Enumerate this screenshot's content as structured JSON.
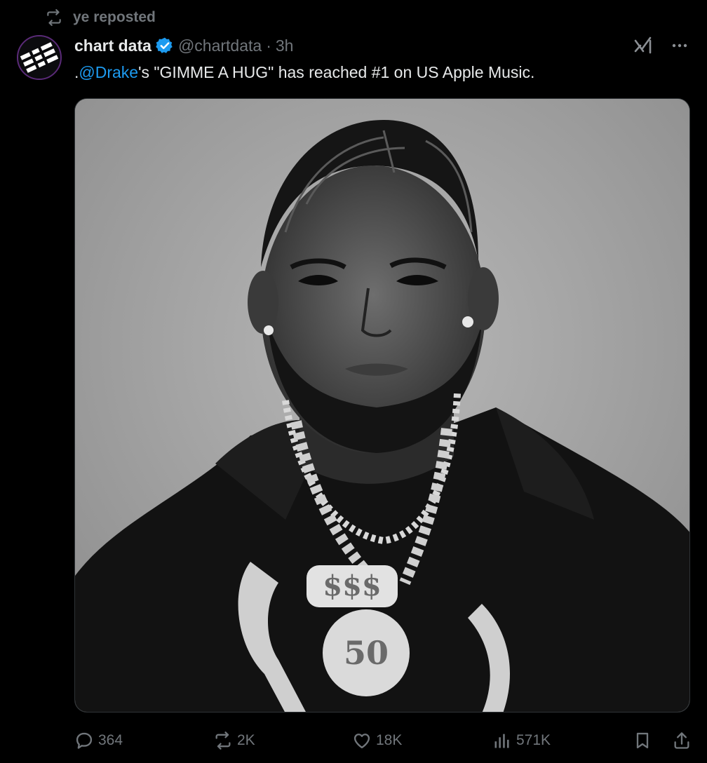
{
  "repost": {
    "icon": "repost-icon",
    "text": "ye reposted"
  },
  "post": {
    "author_name": "chart data",
    "verified_icon": "verified-badge-icon",
    "handle": "@chartdata",
    "separator": "·",
    "time": "3h",
    "text_prefix": ".",
    "mention": "@Drake",
    "text_suffix": "'s \"GIMME A HUG\" has reached #1 on US Apple Music."
  },
  "actions": {
    "replies": "364",
    "reposts": "2K",
    "likes": "18K",
    "views": "571K"
  },
  "colors": {
    "background": "#000000",
    "text": "#e7e9ea",
    "muted": "#71767b",
    "accent": "#1d9bf0"
  }
}
